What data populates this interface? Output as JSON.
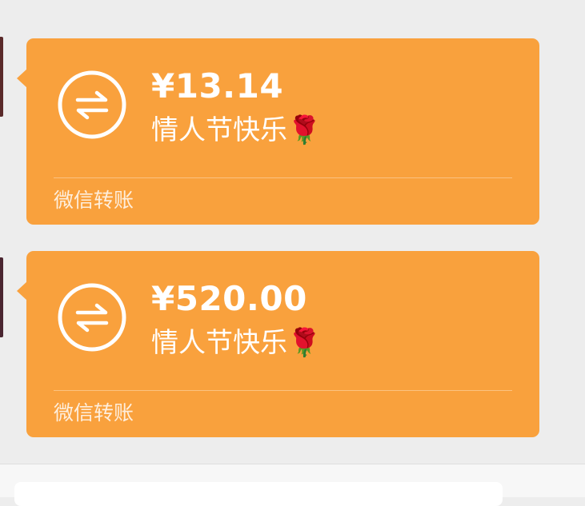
{
  "messages": [
    {
      "amount": "¥13.14",
      "note": "情人节快乐🌹",
      "label": "微信转账"
    },
    {
      "amount": "¥520.00",
      "note": "情人节快乐🌹",
      "label": "微信转账"
    }
  ],
  "icons": {
    "transfer": "transfer-arrows-icon",
    "rose": "rose-emoji"
  },
  "colors": {
    "card": "#f9a13d",
    "background": "#ededed",
    "text": "#ffffff"
  }
}
